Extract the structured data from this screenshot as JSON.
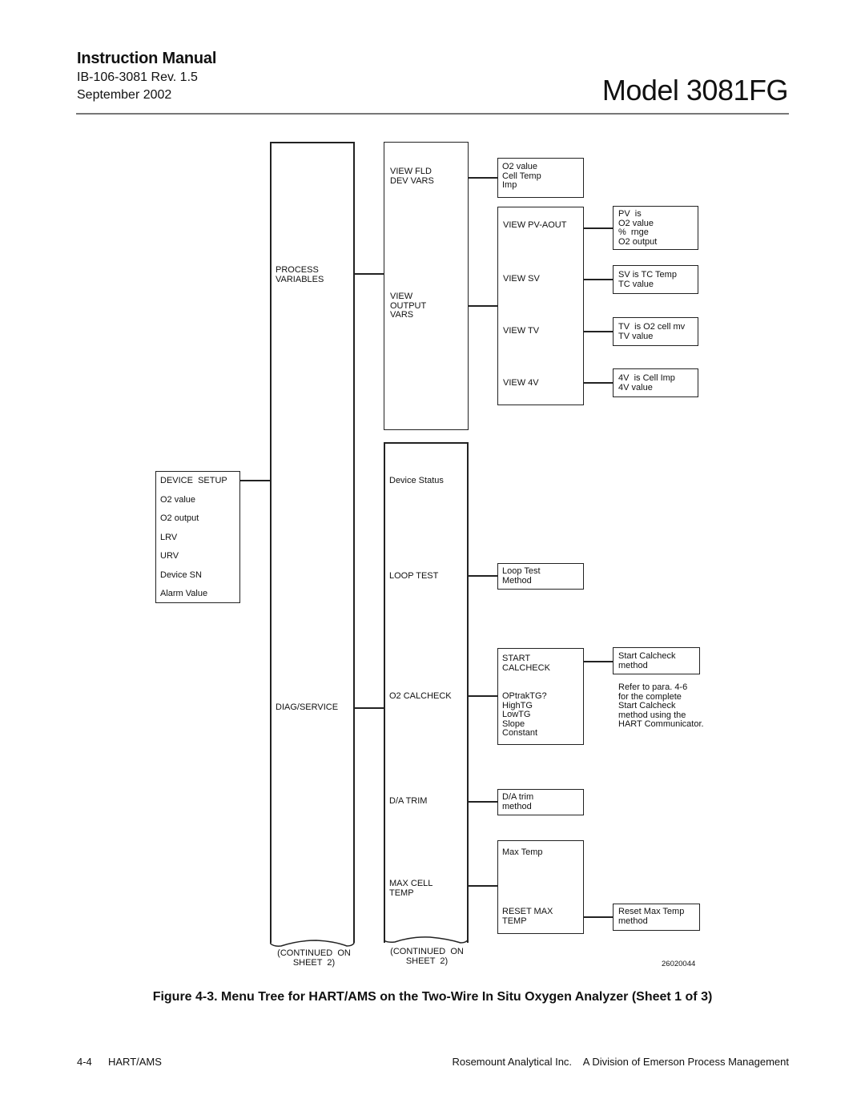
{
  "header": {
    "title": "Instruction Manual",
    "doc_number": "IB-106-3081 Rev. 1.5",
    "date": "September 2002",
    "model": "Model 3081FG"
  },
  "diagram": {
    "device_setup": {
      "title": "DEVICE  SETUP",
      "items": [
        "O2 value",
        "O2 output",
        "LRV",
        "URV",
        "Device SN",
        "Alarm Value"
      ]
    },
    "level1": {
      "process_variables": "PROCESS\nVARIABLES",
      "diag_service": "DIAG/SERVICE",
      "continued": "(CONTINUED  ON\nSHEET  2)"
    },
    "process_vars_menu": {
      "view_fld_dev_vars": "VIEW FLD\nDEV VARS",
      "view_output_vars": "VIEW\nOUTPUT\nVARS"
    },
    "fld_dev_vars_box": "O2 value\nCell Temp\nImp",
    "output_vars_menu": {
      "view_pv_aout": "VIEW PV-AOUT",
      "view_sv": "VIEW SV",
      "view_tv": "VIEW TV",
      "view_4v": "VIEW 4V"
    },
    "pv_box": "PV  is\nO2 value\n%  rnge\nO2 output",
    "sv_box": "SV is TC Temp\nTC value",
    "tv_box": "TV  is O2 cell mv\nTV value",
    "fv_box": "4V  is Cell Imp\n4V value",
    "diag_menu": {
      "device_status": "Device Status",
      "loop_test": "LOOP TEST",
      "o2_calcheck": "O2 CALCHECK",
      "da_trim": "D/A TRIM",
      "max_cell_temp": "MAX CELL\nTEMP",
      "continued": "(CONTINUED  ON\nSHEET  2)"
    },
    "loop_test_box": "Loop Test\nMethod",
    "calcheck_menu": {
      "start_calcheck": "START\nCALCHECK",
      "params": "OPtrakTG?\nHighTG\nLowTG\nSlope\nConstant"
    },
    "start_calcheck_box": "Start Calcheck\nmethod",
    "calcheck_note": "Refer to para. 4-6\nfor the complete\nStart Calcheck\nmethod using the\nHART Communicator.",
    "da_trim_box": "D/A trim\nmethod",
    "max_temp_menu": {
      "max_temp": "Max Temp",
      "reset_max_temp": "RESET MAX\nTEMP"
    },
    "reset_max_temp_box": "Reset Max Temp\nmethod",
    "figure_id": "26020044"
  },
  "caption": "Figure 4-3.  Menu Tree for HART/AMS on the Two-Wire In Situ Oxygen Analyzer (Sheet 1 of 3)",
  "footer": {
    "page": "4-4",
    "section": "HART/AMS",
    "company": "Rosemount Analytical Inc.    A Division of Emerson Process Management"
  }
}
